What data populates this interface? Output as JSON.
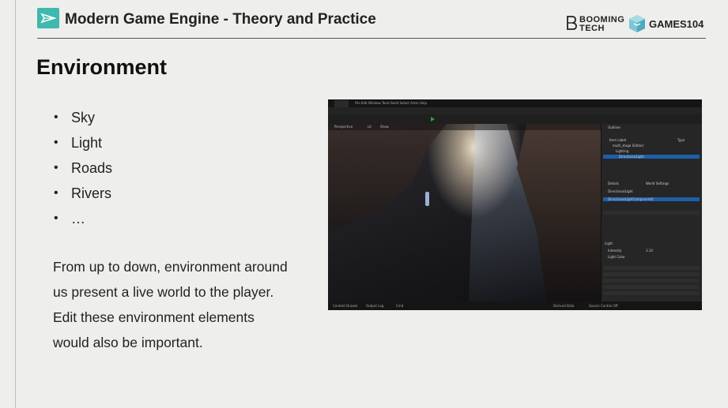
{
  "header": {
    "course_title": "Modern Game Engine - Theory and Practice",
    "brand_booming": "BOOMING\nTECH",
    "brand_games": "GAMES104"
  },
  "slide": {
    "title": "Environment",
    "bullets": [
      "Sky",
      "Light",
      "Roads",
      "Rivers",
      "…"
    ],
    "bullet_marker": "•",
    "paragraph": "From up to down, environment around us present a live world to the player. Edit these environment elements would also be important."
  },
  "screenshot": {
    "menu": "File  Edit  Window  Tools  Build  Select  Actor  Help",
    "viewport_labels": [
      "Perspective",
      "Lit",
      "Show"
    ],
    "outliner_title": "Outliner",
    "outliner_items": [
      "Item Label",
      "multi_stage (Editor)",
      "Lighting",
      "DirectionalLight"
    ],
    "outliner_type_header": "Type",
    "details_title": "Details",
    "world_settings": "World Settings",
    "selected_actor": "DirectionalLight",
    "component": "DirectionalLightComponent0",
    "section_light": "Light",
    "prop_intensity": "Intensity",
    "prop_intensity_value": "3.14",
    "prop_color": "Light Color",
    "status_items": [
      "Content Drawer",
      "Output Log",
      "Cmd"
    ],
    "status_right": [
      "Derived Data",
      "Source Control Off"
    ]
  },
  "colors": {
    "background": "#eeeeec",
    "logo_accent": "#3fb8ad",
    "editor_highlight": "#1d5fa8"
  },
  "icons": {
    "logo": "paper-plane-icon",
    "booming": "booming-b-icon",
    "games": "games-cube-icon"
  }
}
